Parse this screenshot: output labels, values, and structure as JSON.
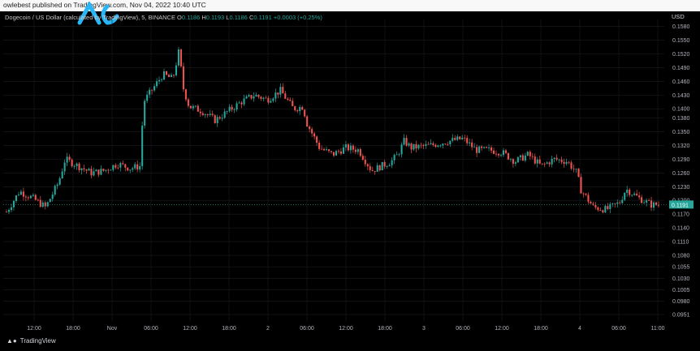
{
  "header": {
    "publisher_text": "owlebest published on TradingView.com, Nov 04, 2022 10:40 UTC",
    "pair_title": "Dogecoin / US Dollar (calculated by TradingView), 5, BINANCE",
    "open_label": "O",
    "open_value": "0.1186",
    "high_label": "H",
    "high_value": "0.1193",
    "low_label": "L",
    "low_value": "0.1186",
    "close_label": "C",
    "close_value": "0.1191",
    "change_text": "+0.0003 (+0.25%)",
    "currency": "USD"
  },
  "footer": {
    "brand": "TradingView"
  },
  "colors": {
    "up": "#26a69a",
    "down": "#ef5350",
    "grid": "#1b1d24",
    "price_tag": "#26a69a",
    "logo": "#29b6f6"
  },
  "icons": {
    "logo": "tradingview-c-logo-icon"
  },
  "chart_data": {
    "type": "candlestick",
    "timeframe": "5",
    "ylim": [
      0.0935,
      0.1595
    ],
    "y_ticks": [
      "0.1580",
      "0.1550",
      "0.1520",
      "0.1490",
      "0.1460",
      "0.1430",
      "0.1400",
      "0.1380",
      "0.1350",
      "0.1320",
      "0.1290",
      "0.1260",
      "0.1230",
      "0.1200",
      "0.1170",
      "0.1140",
      "0.1110",
      "0.1080",
      "0.1055",
      "0.1030",
      "0.1005",
      "0.0980",
      "0.0951"
    ],
    "x_ticks": [
      "12:00",
      "18:00",
      "Nov",
      "06:00",
      "12:00",
      "18:00",
      "2",
      "06:00",
      "12:00",
      "18:00",
      "3",
      "06:00",
      "12:00",
      "18:00",
      "4",
      "06:00",
      "11:00"
    ],
    "last_price": "0.1191",
    "trajectory_x": [
      0,
      0.02,
      0.04,
      0.06,
      0.08,
      0.09,
      0.11,
      0.13,
      0.15,
      0.17,
      0.19,
      0.205,
      0.21,
      0.225,
      0.24,
      0.255,
      0.265,
      0.27,
      0.28,
      0.3,
      0.32,
      0.34,
      0.36,
      0.38,
      0.4,
      0.42,
      0.44,
      0.455,
      0.46,
      0.48,
      0.5,
      0.52,
      0.54,
      0.56,
      0.59,
      0.6,
      0.61,
      0.62,
      0.65,
      0.68,
      0.7,
      0.72,
      0.74,
      0.76,
      0.78,
      0.8,
      0.82,
      0.84,
      0.86,
      0.875,
      0.88,
      0.9,
      0.92,
      0.94,
      0.95,
      0.97,
      0.99,
      1.0
    ],
    "trajectory_y": [
      0.1175,
      0.122,
      0.1205,
      0.1185,
      0.124,
      0.129,
      0.1275,
      0.126,
      0.1265,
      0.128,
      0.127,
      0.1275,
      0.1415,
      0.1445,
      0.1475,
      0.1465,
      0.153,
      0.145,
      0.1405,
      0.1395,
      0.1375,
      0.1395,
      0.1415,
      0.143,
      0.142,
      0.144,
      0.14,
      0.1405,
      0.137,
      0.1315,
      0.13,
      0.1315,
      0.131,
      0.1265,
      0.1285,
      0.13,
      0.133,
      0.1315,
      0.132,
      0.133,
      0.1335,
      0.131,
      0.131,
      0.1305,
      0.1285,
      0.13,
      0.1275,
      0.129,
      0.1285,
      0.126,
      0.1225,
      0.1185,
      0.118,
      0.1195,
      0.1225,
      0.1205,
      0.119,
      0.1191
    ]
  }
}
